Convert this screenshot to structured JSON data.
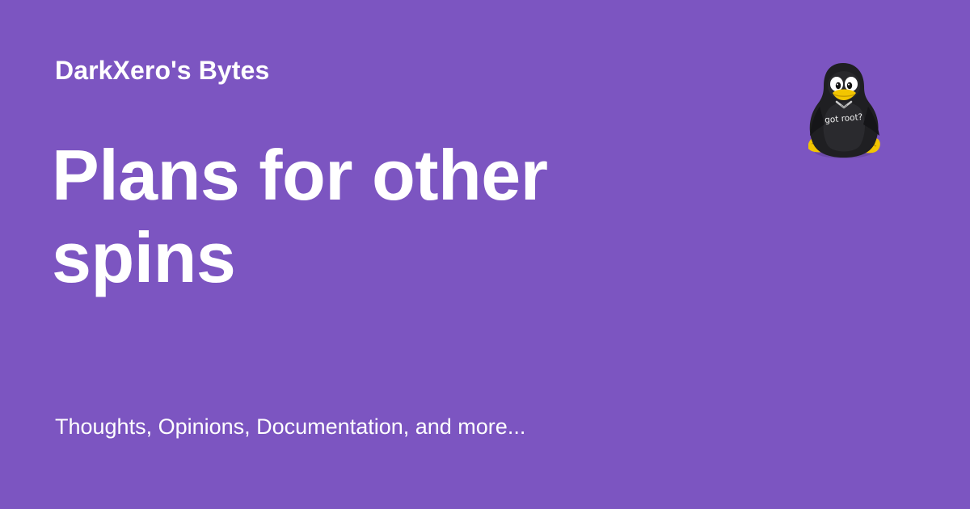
{
  "site": {
    "name": "DarkXero's Bytes"
  },
  "post": {
    "title": "Plans for other spins"
  },
  "tagline": "Thoughts, Opinions, Documentation, and more...",
  "logo": {
    "icon": "penguin-got-root-icon",
    "shirt_text": "got root?"
  },
  "colors": {
    "background": "#7c55c1",
    "text": "#ffffff",
    "penguin_body": "#1f1f22",
    "penguin_beak_feet": "#f2c500"
  }
}
